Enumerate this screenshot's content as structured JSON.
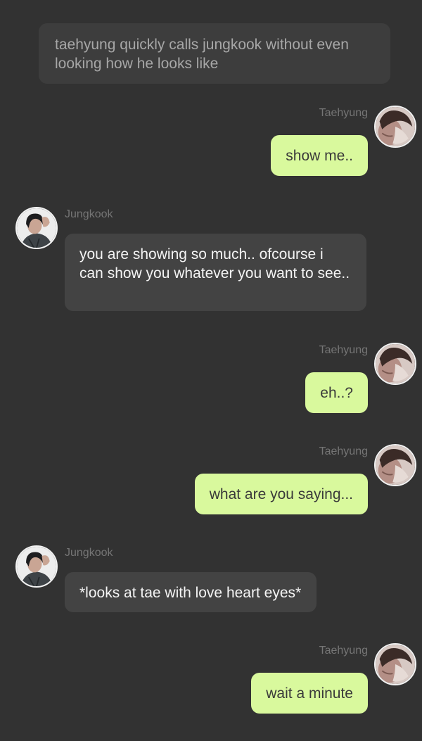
{
  "narration": "taehyung quickly calls jungkook without even looking how he looks like",
  "colors": {
    "background": "#323232",
    "outgoing_bubble": "#d9f99d",
    "incoming_bubble": "#434343",
    "narration_bubble": "#3d3d3d",
    "sender_name": "#757575"
  },
  "messages": [
    {
      "sender": "Taehyung",
      "side": "right",
      "avatar": "taehyung-avatar",
      "text": "show me.."
    },
    {
      "sender": "Jungkook",
      "side": "left",
      "avatar": "jungkook-avatar",
      "text": "you are showing so much.. ofcourse i can show you whatever you want to see.."
    },
    {
      "sender": "Taehyung",
      "side": "right",
      "avatar": "taehyung-avatar",
      "text": "eh..?"
    },
    {
      "sender": "Taehyung",
      "side": "right",
      "avatar": "taehyung-avatar",
      "text": "what are you saying..."
    },
    {
      "sender": "Jungkook",
      "side": "left",
      "avatar": "jungkook-avatar",
      "text": "*looks at tae with love heart eyes*"
    },
    {
      "sender": "Taehyung",
      "side": "right",
      "avatar": "taehyung-avatar",
      "text": "wait a minute"
    }
  ]
}
